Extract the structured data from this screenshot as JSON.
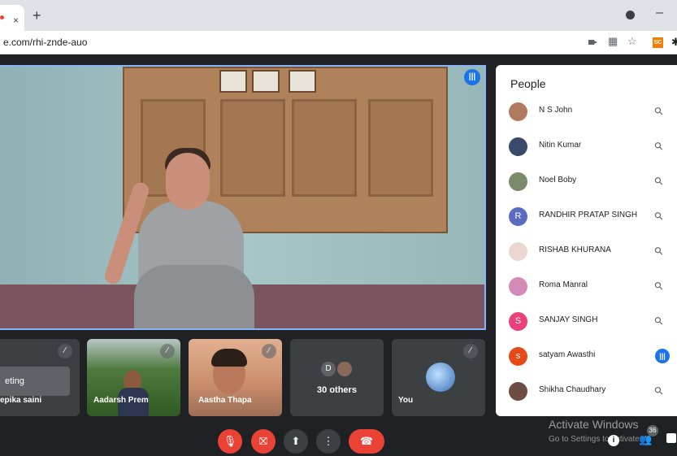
{
  "browser": {
    "url": "e.com/rhi-znde-auo",
    "tab_close": "×",
    "new_tab": "+",
    "minimize": "–",
    "toolbar_icons": [
      "camera-icon",
      "qr-icon",
      "bookmark-star-icon"
    ],
    "extension_label": "SC"
  },
  "stage": {
    "speaking_indicator": "audio-level-icon"
  },
  "tiles": [
    {
      "name": "epika saini",
      "tooltip": "eting",
      "mic": "muted"
    },
    {
      "name": "Aadarsh Prem",
      "mic": "muted"
    },
    {
      "name": "Aastha Thapa",
      "mic": "muted"
    },
    {
      "initial": "D",
      "label": "30 others"
    },
    {
      "name": "You",
      "mic": "muted"
    }
  ],
  "people_panel": {
    "title": "People",
    "participants": [
      {
        "name": "N S John",
        "avatar": "photo",
        "color": "#b07a5e",
        "status": "muted"
      },
      {
        "name": "Nitin Kumar",
        "avatar": "photo",
        "color": "#3a4a6a",
        "status": "muted"
      },
      {
        "name": "Noel Boby",
        "avatar": "photo",
        "color": "#7a8a6a",
        "status": "muted"
      },
      {
        "name": "RANDHIR PRATAP SINGH",
        "avatar": "R",
        "color": "#5c6bc0",
        "status": "muted"
      },
      {
        "name": "RISHAB KHURANA",
        "avatar": "photo",
        "color": "#ead7d0",
        "status": "muted"
      },
      {
        "name": "Roma Manral",
        "avatar": "photo",
        "color": "#d48ab6",
        "status": "muted"
      },
      {
        "name": "SANJAY SINGH",
        "avatar": "S",
        "color": "#ec407a",
        "status": "muted"
      },
      {
        "name": "satyam Awasthi",
        "avatar": "s",
        "color": "#e64a19",
        "status": "speaking"
      },
      {
        "name": "Shikha Chaudhary",
        "avatar": "photo",
        "color": "#6d4c41",
        "status": "muted"
      }
    ]
  },
  "controls": {
    "colors": {
      "danger": "#ea4335",
      "neutral": "#3c4043",
      "accent": "#1a73e8"
    }
  },
  "watermark": {
    "line1": "Activate Windows",
    "line2": "Go to Settings to activate Wi",
    "participant_count": "36"
  }
}
